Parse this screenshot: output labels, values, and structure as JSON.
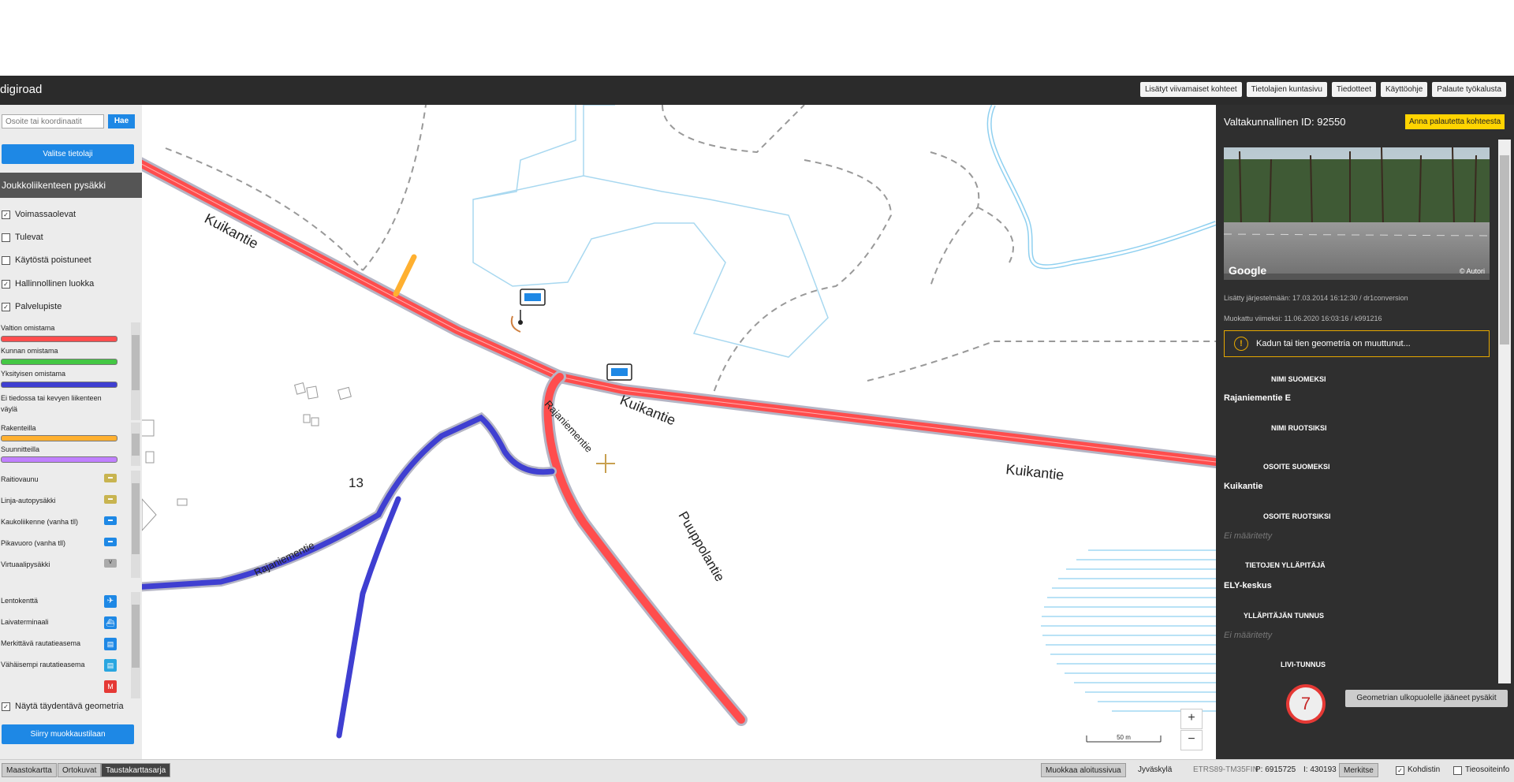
{
  "app": {
    "logo": "digiroad",
    "top_links": [
      "Lisätyt viivamaiset kohteet",
      "Tietolajien kuntasivu",
      "Tiedotteet",
      "Käyttöohje",
      "Palaute työkalusta"
    ]
  },
  "left_panel": {
    "search_placeholder": "Osoite tai koordinaatit",
    "search_button": "Hae",
    "select_layer_button": "Valitse tietolaji",
    "layer_title": "Joukkoliikenteen pysäkki",
    "filters": [
      {
        "label": "Voimassaolevat",
        "checked": true
      },
      {
        "label": "Tulevat",
        "checked": false
      },
      {
        "label": "Käytöstä poistuneet",
        "checked": false
      },
      {
        "label": "Hallinnollinen luokka",
        "checked": true
      },
      {
        "label": "Palvelupiste",
        "checked": true
      }
    ],
    "ownership_legend": [
      {
        "label": "Valtion omistama",
        "color": "#ff4d4d"
      },
      {
        "label": "Kunnan omistama",
        "color": "#44c744"
      },
      {
        "label": "Yksityisen omistama",
        "color": "#3f3fd1"
      },
      {
        "label": "Ei tiedossa tai kevyen liikenteen väylä",
        "color": "#999999"
      }
    ],
    "construction_legend": [
      {
        "label": "Rakenteilla",
        "color": "#ffb030"
      },
      {
        "label": "Suunnitteilla",
        "color": "#c080ff"
      }
    ],
    "stop_types": [
      {
        "label": "Raitiovaunu",
        "icon": "tram-icon",
        "color": "#c8b450"
      },
      {
        "label": "Linja-autopysäkki",
        "icon": "bus-icon",
        "color": "#c8b450"
      },
      {
        "label": "Kaukoliikenne (vanha tll)",
        "icon": "coach-icon",
        "color": "#1e88e5"
      },
      {
        "label": "Pikavuoro (vanha tll)",
        "icon": "express-icon",
        "color": "#1e88e5"
      },
      {
        "label": "Virtuaalipysäkki",
        "icon": "virtual-icon",
        "color": "#aaaaaa"
      }
    ],
    "service_points": [
      {
        "label": "Lentokenttä",
        "icon": "airplane-icon"
      },
      {
        "label": "Laivaterminaali",
        "icon": "ship-icon"
      },
      {
        "label": "Merkittävä rautatieasema",
        "icon": "train-icon"
      },
      {
        "label": "Vähäisempi rautatieasema",
        "icon": "train-small-icon"
      },
      {
        "label": "Metro",
        "icon": "metro-icon"
      }
    ],
    "supplementary_geometry": {
      "label": "Näytä täydentävä geometria",
      "checked": true
    },
    "edit_button": "Siirry muokkaustilaan"
  },
  "map": {
    "labels": {
      "kuikantie_1": "Kuikantie",
      "kuikantie_2": "Kuikantie",
      "kuikantie_3": "Kuikantie",
      "rajaniementie_1": "Rajaniementie",
      "rajaniementie_2": "Rajaniementie",
      "puuppolantie": "Puuppolantie",
      "building_number": "13"
    },
    "scale_label": "50 m",
    "zoom_in": "+",
    "zoom_out": "−"
  },
  "right_panel": {
    "title": "Valtakunnallinen ID: 92550",
    "feedback_button": "Anna palautetta kohteesta",
    "streetview_brand": "Google",
    "streetview_credit": "© Autori",
    "added": "Lisätty järjestelmään: 17.03.2014 16:12:30 / dr1conversion",
    "modified": "Muokattu viimeksi: 11.06.2020 16:03:16 / k991216",
    "warning": "Kadun tai tien geometria on muuttunut...",
    "fields": [
      {
        "label": "NIMI SUOMEKSI",
        "value": "Rajaniementie E"
      },
      {
        "label": "NIMI RUOTSIKSI",
        "value": ""
      },
      {
        "label": "OSOITE SUOMEKSI",
        "value": "Kuikantie"
      },
      {
        "label": "OSOITE RUOTSIKSI",
        "value": "Ei määritetty"
      },
      {
        "label": "TIETOJEN YLLÄPITÄJÄ",
        "value": "ELY-keskus"
      },
      {
        "label": "YLLÄPITÄJÄN TUNNUS",
        "value": "Ei määritetty"
      },
      {
        "label": "LIVI-TUNNUS",
        "value": ""
      }
    ],
    "geometry_button": "Geometrian ulkopuolelle jääneet pysäkit",
    "badge_count": "7"
  },
  "bottom_bar": {
    "basemaps": [
      "Maastokartta",
      "Ortokuvat",
      "Taustakarttasarja"
    ],
    "active_basemap": "Taustakarttasarja",
    "edit_start_button": "Muokkaa aloitussivua",
    "municipality": "Jyväskylä",
    "coord_system": "ETRS89-TM35FIN",
    "coord_p": "P: 6915725",
    "coord_i": "I: 430193",
    "mark_button": "Merkitse",
    "crosshair_label": "Kohdistin",
    "crosshair_checked": true,
    "road_info_label": "Tieosoiteinfo",
    "road_info_checked": false
  }
}
